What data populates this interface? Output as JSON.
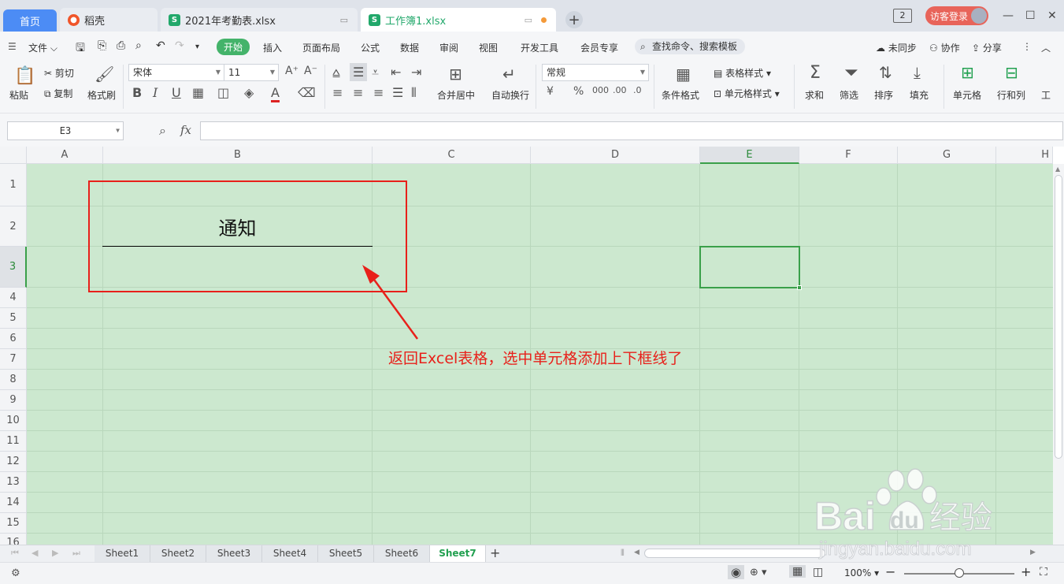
{
  "tabs": {
    "home": "首页",
    "t2": "稻壳",
    "t3": "2021年考勤表.xlsx",
    "t4": "工作簿1.xlsx",
    "new": "+"
  },
  "topright": {
    "badge": "2",
    "login": "访客登录"
  },
  "menu": {
    "file": "文件",
    "items": [
      "开始",
      "插入",
      "页面布局",
      "公式",
      "数据",
      "审阅",
      "视图",
      "开发工具",
      "会员专享"
    ],
    "search": "查找命令、搜索模板",
    "sync": "未同步",
    "collab": "协作",
    "share": "分享"
  },
  "ribbon": {
    "paste": "粘贴",
    "cut": "剪切",
    "copy": "复制",
    "format_painter": "格式刷",
    "font": "宋体",
    "size": "11",
    "merge": "合并居中",
    "wrap": "自动换行",
    "numfmt": "常规",
    "cond": "条件格式",
    "table_style": "表格样式",
    "cell_style": "单元格样式",
    "sum": "求和",
    "filter": "筛选",
    "sort": "排序",
    "fill": "填充",
    "cell": "单元格",
    "rowcol": "行和列",
    "ws": "工"
  },
  "formula": {
    "namebox": "E3",
    "fx": "fx",
    "value": ""
  },
  "columns": [
    "A",
    "B",
    "C",
    "D",
    "E",
    "F",
    "G",
    "H"
  ],
  "rows": [
    "1",
    "2",
    "3",
    "4",
    "5",
    "6",
    "7",
    "8",
    "9",
    "10",
    "11",
    "12",
    "13",
    "14",
    "15",
    "16"
  ],
  "cell_B2": "通知",
  "annotation": "返回Excel表格，选中单元格添加上下框线了",
  "sheets": [
    "Sheet1",
    "Sheet2",
    "Sheet3",
    "Sheet4",
    "Sheet5",
    "Sheet6",
    "Sheet7"
  ],
  "active_sheet": "Sheet7",
  "status": {
    "zoom": "100%",
    "zoom_level": 0.5
  },
  "watermark": {
    "brand": "Bai du 经验",
    "url": "jingyan.baidu.com"
  },
  "colors": {
    "accent": "#44b36a",
    "cell_bg": "#cce8cf",
    "annotation": "#e8201a",
    "home_tab": "#4c8cf5"
  }
}
